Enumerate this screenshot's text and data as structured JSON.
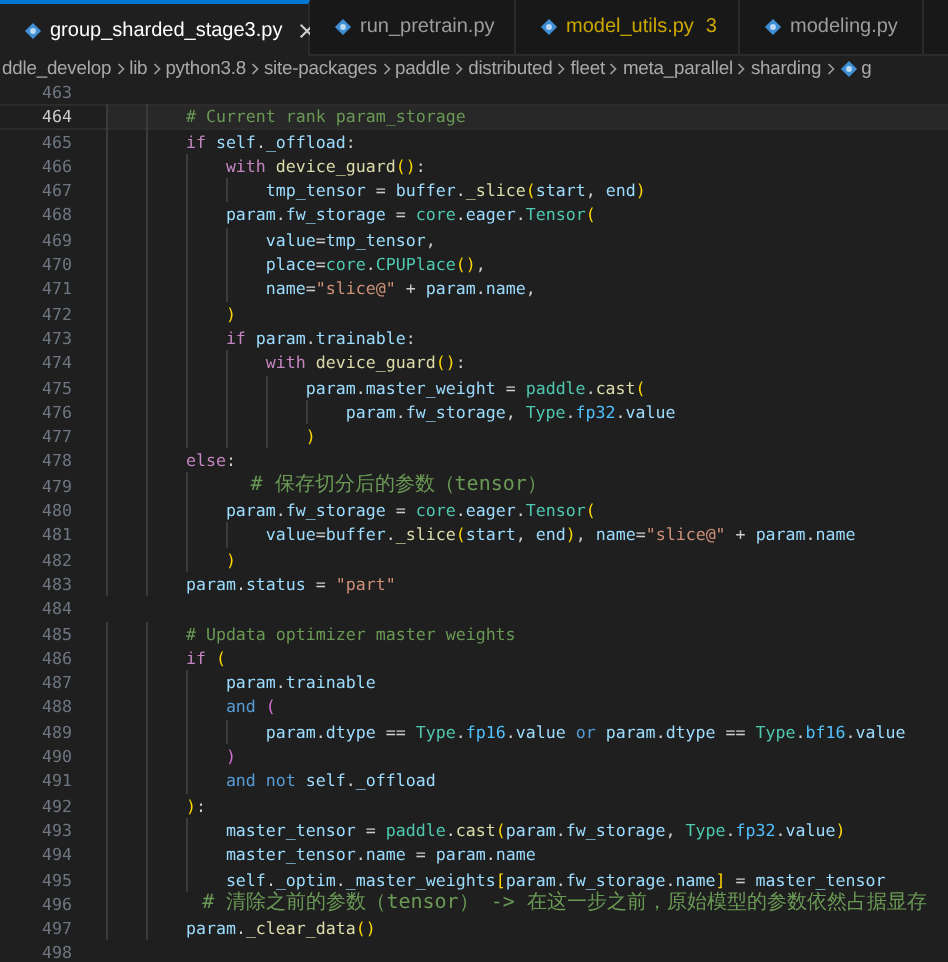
{
  "tabs": [
    {
      "label": "group_sharded_stage3.py",
      "selected": true,
      "has_problems": false
    },
    {
      "label": "run_pretrain.py",
      "selected": false,
      "has_problems": false
    },
    {
      "label": "model_utils.py",
      "selected": false,
      "has_problems": true,
      "badge": "3"
    },
    {
      "label": "modeling.py",
      "selected": false,
      "has_problems": false
    }
  ],
  "breadcrumb": [
    {
      "label": "ddle_develop",
      "kind": "folder"
    },
    {
      "label": "lib",
      "kind": "folder"
    },
    {
      "label": "python3.8",
      "kind": "folder"
    },
    {
      "label": "site-packages",
      "kind": "folder"
    },
    {
      "label": "paddle",
      "kind": "folder"
    },
    {
      "label": "distributed",
      "kind": "folder"
    },
    {
      "label": "fleet",
      "kind": "folder"
    },
    {
      "label": "meta_parallel",
      "kind": "folder"
    },
    {
      "label": "sharding",
      "kind": "folder"
    },
    {
      "label": "g",
      "kind": "python_file"
    }
  ],
  "lines": [
    {
      "number": "463",
      "current": false
    },
    {
      "number": "464",
      "current": true,
      "tokens": [
        {
          "text": "        # Current rank param_storage",
          "kind": "comment"
        }
      ]
    },
    {
      "number": "465",
      "current": false,
      "tokens": [
        {
          "text": "        if",
          "kind": "control"
        },
        {
          "text": " self",
          "kind": "var"
        },
        {
          "text": ".",
          "kind": "plain"
        },
        {
          "text": "_offload",
          "kind": "var"
        },
        {
          "text": ":",
          "kind": "plain"
        }
      ]
    },
    {
      "number": "466",
      "current": false,
      "tokens": [
        {
          "text": "            with",
          "kind": "control"
        },
        {
          "text": " device_guard",
          "kind": "func"
        },
        {
          "text": "()",
          "kind": "paren"
        },
        {
          "text": ":",
          "kind": "plain"
        }
      ]
    },
    {
      "number": "467",
      "current": false,
      "tokens": [
        {
          "text": "                tmp_tensor",
          "kind": "var"
        },
        {
          "text": " = ",
          "kind": "plain"
        },
        {
          "text": "buffer",
          "kind": "var"
        },
        {
          "text": ".",
          "kind": "plain"
        },
        {
          "text": "_slice",
          "kind": "func"
        },
        {
          "text": "(",
          "kind": "paren"
        },
        {
          "text": "start",
          "kind": "var"
        },
        {
          "text": ", ",
          "kind": "plain"
        },
        {
          "text": "end",
          "kind": "var"
        },
        {
          "text": ")",
          "kind": "paren"
        }
      ]
    },
    {
      "number": "468",
      "current": false,
      "tokens": [
        {
          "text": "            param",
          "kind": "var"
        },
        {
          "text": ".",
          "kind": "plain"
        },
        {
          "text": "fw_storage",
          "kind": "var"
        },
        {
          "text": " = ",
          "kind": "plain"
        },
        {
          "text": "core",
          "kind": "class"
        },
        {
          "text": ".",
          "kind": "plain"
        },
        {
          "text": "eager",
          "kind": "var"
        },
        {
          "text": ".",
          "kind": "plain"
        },
        {
          "text": "Tensor",
          "kind": "class"
        },
        {
          "text": "(",
          "kind": "paren"
        }
      ]
    },
    {
      "number": "469",
      "current": false,
      "tokens": [
        {
          "text": "                value",
          "kind": "var"
        },
        {
          "text": "=",
          "kind": "plain"
        },
        {
          "text": "tmp_tensor",
          "kind": "var"
        },
        {
          "text": ",",
          "kind": "plain"
        }
      ]
    },
    {
      "number": "470",
      "current": false,
      "tokens": [
        {
          "text": "                place",
          "kind": "var"
        },
        {
          "text": "=",
          "kind": "plain"
        },
        {
          "text": "core",
          "kind": "class"
        },
        {
          "text": ".",
          "kind": "plain"
        },
        {
          "text": "CPUPlace",
          "kind": "class"
        },
        {
          "text": "()",
          "kind": "paren"
        },
        {
          "text": ",",
          "kind": "plain"
        }
      ]
    },
    {
      "number": "471",
      "current": false,
      "tokens": [
        {
          "text": "                name",
          "kind": "var"
        },
        {
          "text": "=",
          "kind": "plain"
        },
        {
          "text": "\"slice@\"",
          "kind": "string"
        },
        {
          "text": " + ",
          "kind": "plain"
        },
        {
          "text": "param",
          "kind": "var"
        },
        {
          "text": ".",
          "kind": "plain"
        },
        {
          "text": "name",
          "kind": "var"
        },
        {
          "text": ",",
          "kind": "plain"
        }
      ]
    },
    {
      "number": "472",
      "current": false,
      "tokens": [
        {
          "text": "            )",
          "kind": "paren"
        }
      ]
    },
    {
      "number": "473",
      "current": false,
      "tokens": [
        {
          "text": "            if",
          "kind": "control"
        },
        {
          "text": " param",
          "kind": "var"
        },
        {
          "text": ".",
          "kind": "plain"
        },
        {
          "text": "trainable",
          "kind": "var"
        },
        {
          "text": ":",
          "kind": "plain"
        }
      ]
    },
    {
      "number": "474",
      "current": false,
      "tokens": [
        {
          "text": "                with",
          "kind": "control"
        },
        {
          "text": " device_guard",
          "kind": "func"
        },
        {
          "text": "()",
          "kind": "paren"
        },
        {
          "text": ":",
          "kind": "plain"
        }
      ]
    },
    {
      "number": "475",
      "current": false,
      "tokens": [
        {
          "text": "                    param",
          "kind": "var"
        },
        {
          "text": ".",
          "kind": "plain"
        },
        {
          "text": "master_weight",
          "kind": "var"
        },
        {
          "text": " = ",
          "kind": "plain"
        },
        {
          "text": "paddle",
          "kind": "class"
        },
        {
          "text": ".",
          "kind": "plain"
        },
        {
          "text": "cast",
          "kind": "func"
        },
        {
          "text": "(",
          "kind": "paren"
        }
      ]
    },
    {
      "number": "476",
      "current": false,
      "tokens": [
        {
          "text": "                        param",
          "kind": "var"
        },
        {
          "text": ".",
          "kind": "plain"
        },
        {
          "text": "fw_storage",
          "kind": "var"
        },
        {
          "text": ", ",
          "kind": "plain"
        },
        {
          "text": "Type",
          "kind": "class"
        },
        {
          "text": ".",
          "kind": "plain"
        },
        {
          "text": "fp32",
          "kind": "const"
        },
        {
          "text": ".",
          "kind": "plain"
        },
        {
          "text": "value",
          "kind": "var"
        }
      ]
    },
    {
      "number": "477",
      "current": false,
      "tokens": [
        {
          "text": "                    )",
          "kind": "paren"
        }
      ]
    },
    {
      "number": "478",
      "current": false,
      "tokens": [
        {
          "text": "        else",
          "kind": "control"
        },
        {
          "text": ":",
          "kind": "plain"
        }
      ]
    },
    {
      "number": "479",
      "current": false,
      "tokens": [
        {
          "text": "            # 保存切分后的参数（tensor）",
          "kind": "wide_comment"
        }
      ]
    },
    {
      "number": "480",
      "current": false,
      "tokens": [
        {
          "text": "            param",
          "kind": "var"
        },
        {
          "text": ".",
          "kind": "plain"
        },
        {
          "text": "fw_storage",
          "kind": "var"
        },
        {
          "text": " = ",
          "kind": "plain"
        },
        {
          "text": "core",
          "kind": "class"
        },
        {
          "text": ".",
          "kind": "plain"
        },
        {
          "text": "eager",
          "kind": "var"
        },
        {
          "text": ".",
          "kind": "plain"
        },
        {
          "text": "Tensor",
          "kind": "class"
        },
        {
          "text": "(",
          "kind": "paren"
        }
      ]
    },
    {
      "number": "481",
      "current": false,
      "tokens": [
        {
          "text": "                value",
          "kind": "var"
        },
        {
          "text": "=",
          "kind": "plain"
        },
        {
          "text": "buffer",
          "kind": "var"
        },
        {
          "text": ".",
          "kind": "plain"
        },
        {
          "text": "_slice",
          "kind": "func"
        },
        {
          "text": "(",
          "kind": "paren"
        },
        {
          "text": "start",
          "kind": "var"
        },
        {
          "text": ", ",
          "kind": "plain"
        },
        {
          "text": "end",
          "kind": "var"
        },
        {
          "text": ")",
          "kind": "paren"
        },
        {
          "text": ", ",
          "kind": "plain"
        },
        {
          "text": "name",
          "kind": "var"
        },
        {
          "text": "=",
          "kind": "plain"
        },
        {
          "text": "\"slice@\"",
          "kind": "string"
        },
        {
          "text": " + ",
          "kind": "plain"
        },
        {
          "text": "param",
          "kind": "var"
        },
        {
          "text": ".",
          "kind": "plain"
        },
        {
          "text": "name",
          "kind": "var"
        }
      ]
    },
    {
      "number": "482",
      "current": false,
      "tokens": [
        {
          "text": "            )",
          "kind": "paren"
        }
      ]
    },
    {
      "number": "483",
      "current": false,
      "tokens": [
        {
          "text": "        param",
          "kind": "var"
        },
        {
          "text": ".",
          "kind": "plain"
        },
        {
          "text": "status",
          "kind": "var"
        },
        {
          "text": " = ",
          "kind": "plain"
        },
        {
          "text": "\"part\"",
          "kind": "string"
        }
      ]
    },
    {
      "number": "484",
      "current": false
    },
    {
      "number": "485",
      "current": false,
      "tokens": [
        {
          "text": "        # Updata optimizer master weights",
          "kind": "comment"
        }
      ]
    },
    {
      "number": "486",
      "current": false,
      "tokens": [
        {
          "text": "        if",
          "kind": "control"
        },
        {
          "text": " (",
          "kind": "paren"
        }
      ]
    },
    {
      "number": "487",
      "current": false,
      "tokens": [
        {
          "text": "            param",
          "kind": "var"
        },
        {
          "text": ".",
          "kind": "plain"
        },
        {
          "text": "trainable",
          "kind": "var"
        }
      ]
    },
    {
      "number": "488",
      "current": false,
      "tokens": [
        {
          "text": "            and",
          "kind": "keyword"
        },
        {
          "text": " (",
          "kind": "paren2"
        }
      ]
    },
    {
      "number": "489",
      "current": false,
      "tokens": [
        {
          "text": "                param",
          "kind": "var"
        },
        {
          "text": ".",
          "kind": "plain"
        },
        {
          "text": "dtype",
          "kind": "var"
        },
        {
          "text": " == ",
          "kind": "plain"
        },
        {
          "text": "Type",
          "kind": "class"
        },
        {
          "text": ".",
          "kind": "plain"
        },
        {
          "text": "fp16",
          "kind": "const"
        },
        {
          "text": ".",
          "kind": "plain"
        },
        {
          "text": "value",
          "kind": "var"
        },
        {
          "text": " or",
          "kind": "keyword"
        },
        {
          "text": " param",
          "kind": "var"
        },
        {
          "text": ".",
          "kind": "plain"
        },
        {
          "text": "dtype",
          "kind": "var"
        },
        {
          "text": " == ",
          "kind": "plain"
        },
        {
          "text": "Type",
          "kind": "class"
        },
        {
          "text": ".",
          "kind": "plain"
        },
        {
          "text": "bf16",
          "kind": "const"
        },
        {
          "text": ".",
          "kind": "plain"
        },
        {
          "text": "value",
          "kind": "var"
        }
      ]
    },
    {
      "number": "490",
      "current": false,
      "tokens": [
        {
          "text": "            )",
          "kind": "paren2"
        }
      ]
    },
    {
      "number": "491",
      "current": false,
      "tokens": [
        {
          "text": "            and",
          "kind": "keyword"
        },
        {
          "text": " not",
          "kind": "keyword"
        },
        {
          "text": " self",
          "kind": "var"
        },
        {
          "text": ".",
          "kind": "plain"
        },
        {
          "text": "_offload",
          "kind": "var"
        }
      ]
    },
    {
      "number": "492",
      "current": false,
      "tokens": [
        {
          "text": "        )",
          "kind": "paren"
        },
        {
          "text": ":",
          "kind": "plain"
        }
      ]
    },
    {
      "number": "493",
      "current": false,
      "tokens": [
        {
          "text": "            master_tensor",
          "kind": "var"
        },
        {
          "text": " = ",
          "kind": "plain"
        },
        {
          "text": "paddle",
          "kind": "class"
        },
        {
          "text": ".",
          "kind": "plain"
        },
        {
          "text": "cast",
          "kind": "func"
        },
        {
          "text": "(",
          "kind": "paren"
        },
        {
          "text": "param",
          "kind": "var"
        },
        {
          "text": ".",
          "kind": "plain"
        },
        {
          "text": "fw_storage",
          "kind": "var"
        },
        {
          "text": ", ",
          "kind": "plain"
        },
        {
          "text": "Type",
          "kind": "class"
        },
        {
          "text": ".",
          "kind": "plain"
        },
        {
          "text": "fp32",
          "kind": "const"
        },
        {
          "text": ".",
          "kind": "plain"
        },
        {
          "text": "value",
          "kind": "var"
        },
        {
          "text": ")",
          "kind": "paren"
        }
      ]
    },
    {
      "number": "494",
      "current": false,
      "tokens": [
        {
          "text": "            master_tensor",
          "kind": "var"
        },
        {
          "text": ".",
          "kind": "plain"
        },
        {
          "text": "name",
          "kind": "var"
        },
        {
          "text": " = ",
          "kind": "plain"
        },
        {
          "text": "param",
          "kind": "var"
        },
        {
          "text": ".",
          "kind": "plain"
        },
        {
          "text": "name",
          "kind": "var"
        }
      ]
    },
    {
      "number": "495",
      "current": false,
      "tokens": [
        {
          "text": "            self",
          "kind": "var"
        },
        {
          "text": ".",
          "kind": "plain"
        },
        {
          "text": "_optim",
          "kind": "var"
        },
        {
          "text": ".",
          "kind": "plain"
        },
        {
          "text": "_master_weights",
          "kind": "var"
        },
        {
          "text": "[",
          "kind": "paren"
        },
        {
          "text": "param",
          "kind": "var"
        },
        {
          "text": ".",
          "kind": "plain"
        },
        {
          "text": "fw_storage",
          "kind": "var"
        },
        {
          "text": ".",
          "kind": "plain"
        },
        {
          "text": "name",
          "kind": "var"
        },
        {
          "text": "]",
          "kind": "paren"
        },
        {
          "text": " = ",
          "kind": "plain"
        },
        {
          "text": "master_tensor",
          "kind": "var"
        }
      ]
    },
    {
      "number": "496",
      "current": false,
      "tokens": [
        {
          "text": "        # 清除之前的参数（tensor） -> 在这一步之前，原始模型的参数依然占据显存",
          "kind": "wide_comment"
        }
      ]
    },
    {
      "number": "497",
      "current": false,
      "tokens": [
        {
          "text": "        param",
          "kind": "var"
        },
        {
          "text": ".",
          "kind": "plain"
        },
        {
          "text": "_clear_data",
          "kind": "func"
        },
        {
          "text": "()",
          "kind": "paren"
        }
      ]
    },
    {
      "number": "498",
      "current": false
    }
  ]
}
